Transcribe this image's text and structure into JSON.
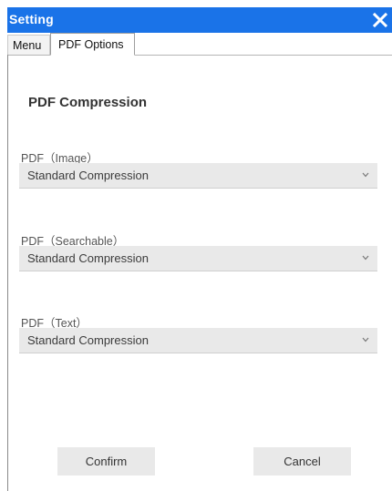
{
  "window": {
    "title": "Setting",
    "close_icon": "close-icon",
    "accent_color": "#1a73e8"
  },
  "tabs": [
    {
      "label": "Menu",
      "active": false
    },
    {
      "label": "PDF Options",
      "active": true
    }
  ],
  "section": {
    "title": "PDF Compression"
  },
  "fields": [
    {
      "label": "PDF（Image）",
      "value": "Standard Compression"
    },
    {
      "label": "PDF（Searchable）",
      "value": "Standard Compression"
    },
    {
      "label": "PDF（Text）",
      "value": "Standard Compression"
    }
  ],
  "buttons": {
    "confirm_label": "Confirm",
    "cancel_label": "Cancel"
  }
}
